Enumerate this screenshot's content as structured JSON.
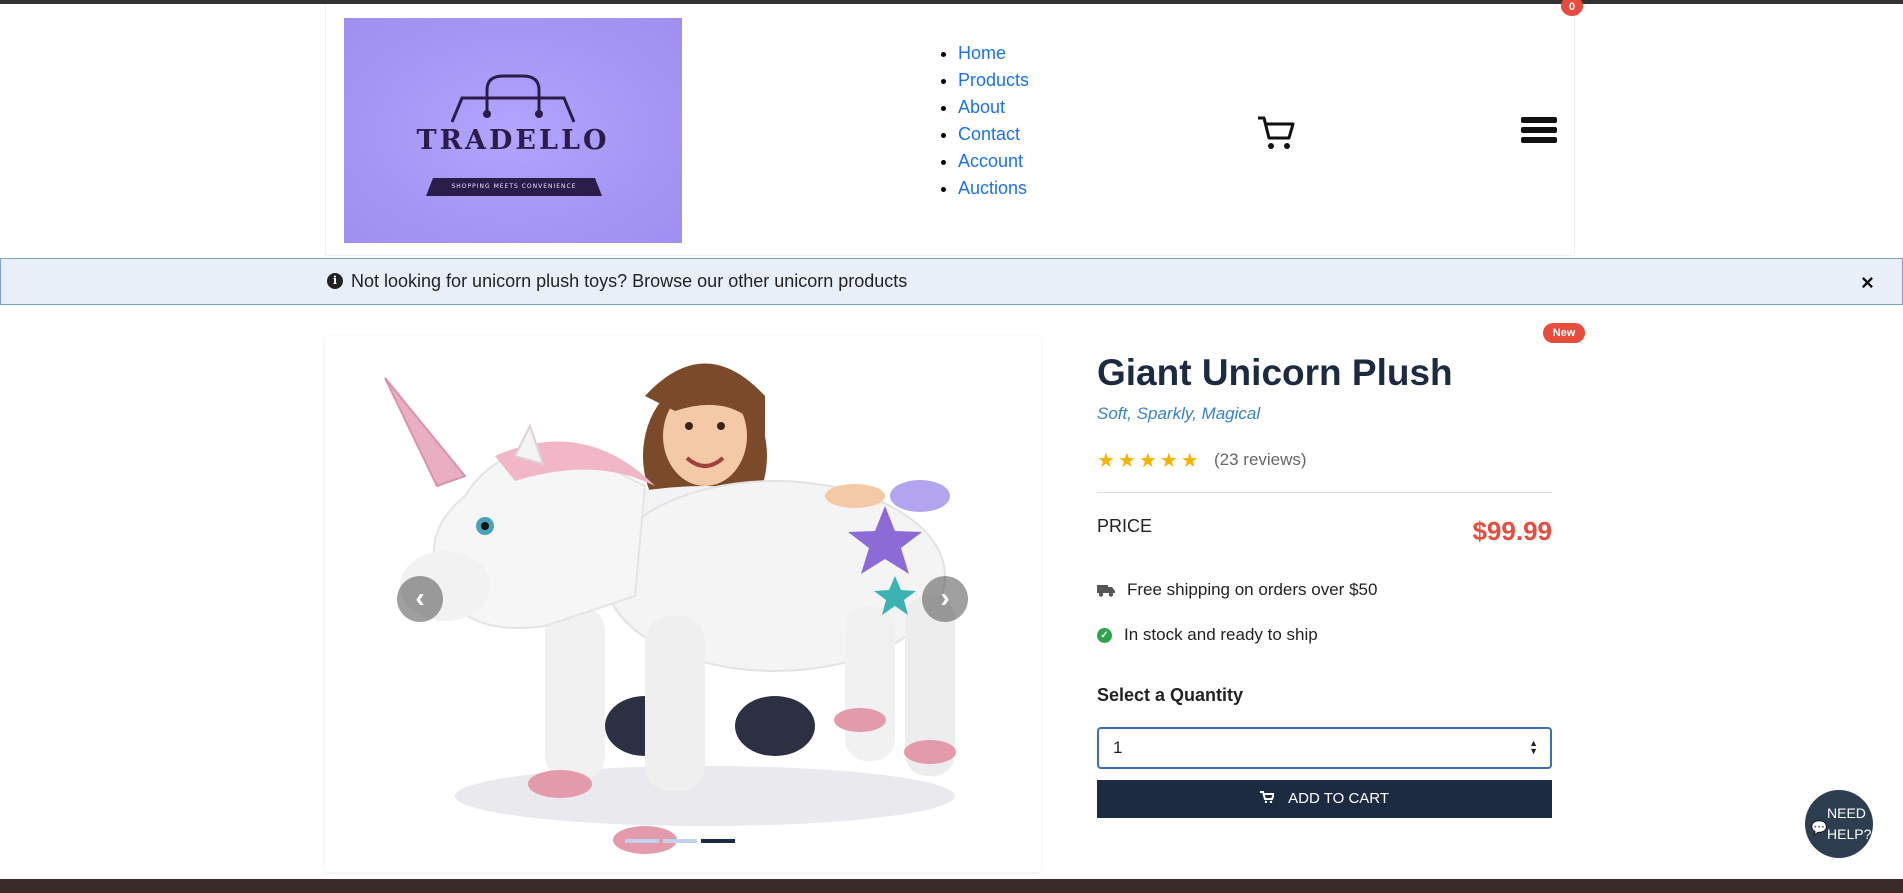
{
  "brand": {
    "name": "TRADELLO",
    "tagline": "SHOPPING MEETS CONVENIENCE"
  },
  "nav": {
    "items": [
      "Home",
      "Products",
      "About",
      "Contact",
      "Account",
      "Auctions"
    ]
  },
  "cart": {
    "count": "0"
  },
  "alert": {
    "text": "Not looking for unicorn plush toys? Browse our other unicorn products",
    "close": "×"
  },
  "product": {
    "badge": "New",
    "title": "Giant Unicorn Plush",
    "subtitle": "Soft, Sparkly, Magical",
    "rating": 5,
    "reviews": "(23 reviews)",
    "price_label": "PRICE",
    "price": "$99.99",
    "shipping": "Free shipping on orders over $50",
    "stock": "In stock and ready to ship",
    "quantity_label": "Select a Quantity",
    "quantity_value": "1",
    "add_to_cart": "ADD TO CART"
  },
  "gallery": {
    "slides": 3,
    "active_slide": 3
  },
  "help": {
    "line1": "NEED",
    "line2": "HELP?"
  },
  "colors": {
    "accent": "#1c2b42",
    "price": "#e74c3c",
    "link": "#1a73e8",
    "logo_bg": "#a596f5"
  }
}
